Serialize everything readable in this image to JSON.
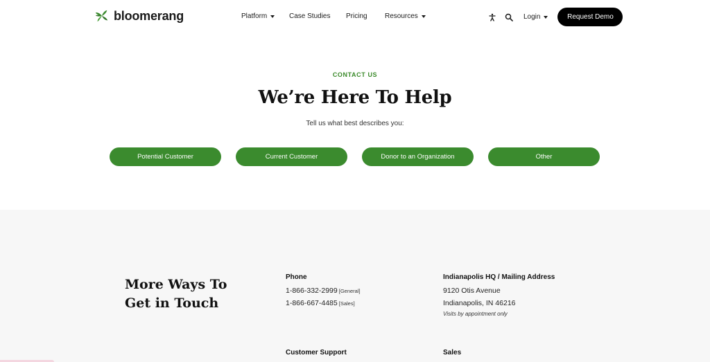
{
  "brand": {
    "name": "bloomerang",
    "accent": "#3b8b2e"
  },
  "nav": {
    "items": [
      {
        "label": "Platform",
        "has_menu": true
      },
      {
        "label": "Case Studies",
        "has_menu": false
      },
      {
        "label": "Pricing",
        "has_menu": false
      },
      {
        "label": "Resources",
        "has_menu": true
      }
    ],
    "login": "Login",
    "cta": "Request Demo"
  },
  "hero": {
    "eyebrow": "CONTACT US",
    "title": "We’re Here To Help",
    "subtitle": "Tell us what best describes you:",
    "options": [
      "Potential Customer",
      "Current Customer",
      "Donor to an Organization",
      "Other"
    ]
  },
  "contact": {
    "title_line1": "More Ways To",
    "title_line2": "Get in Touch",
    "phone": {
      "heading": "Phone",
      "lines": [
        {
          "number": "1-866-332-2999",
          "tag": "[General]"
        },
        {
          "number": "1-866-667-4485",
          "tag": "[Sales]"
        }
      ]
    },
    "hq": {
      "heading": "Indianapolis HQ / Mailing Address",
      "street": "9120 Otis Avenue",
      "city": "Indianapolis, IN 46216",
      "note": "Visits by appointment only"
    },
    "support": {
      "heading": "Customer Support"
    },
    "sales": {
      "heading": "Sales"
    }
  }
}
